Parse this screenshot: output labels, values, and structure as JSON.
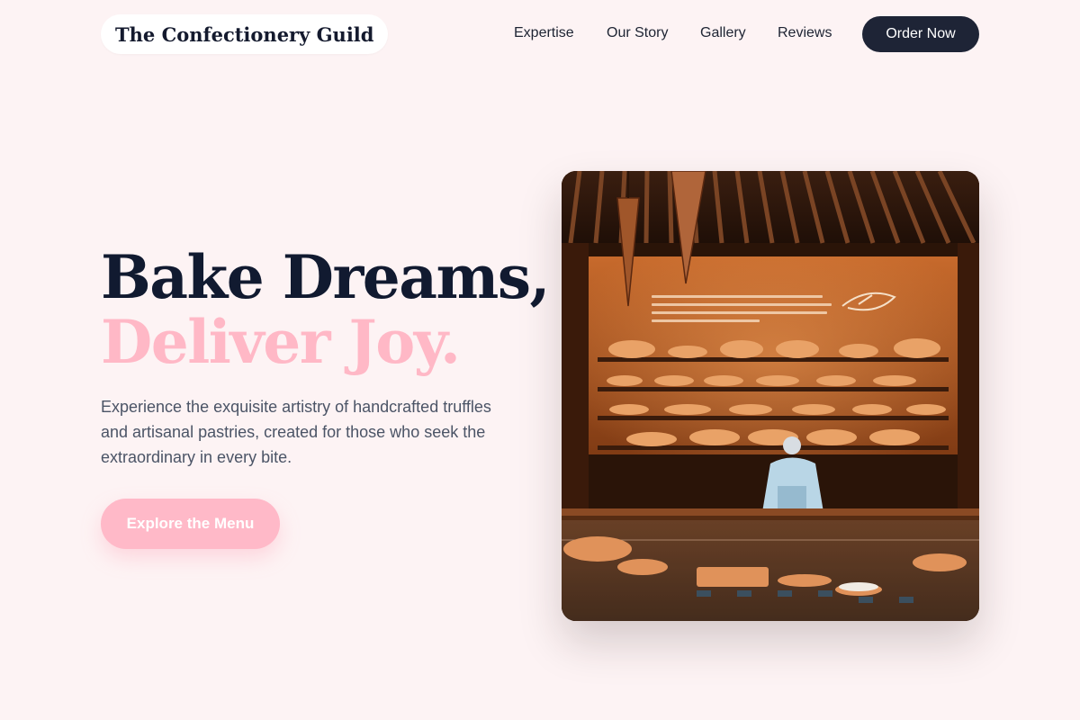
{
  "header": {
    "brand": "The Confectionery Guild",
    "nav": [
      "Expertise",
      "Our Story",
      "Gallery",
      "Reviews"
    ],
    "order_label": "Order Now"
  },
  "hero": {
    "headline_line1": "Bake Dreams,",
    "headline_line2": "Deliver Joy.",
    "description": "Experience the exquisite artistry of handcrafted truffles and artisanal pastries, created for those who seek the extraordinary in every bite.",
    "cta_label": "Explore the Menu",
    "image_name": "bakery-counter-photo"
  },
  "colors": {
    "background": "#fdf3f4",
    "navy": "#1e2436",
    "pink_accent": "#ffb8c6",
    "body_text": "#4b5466"
  }
}
